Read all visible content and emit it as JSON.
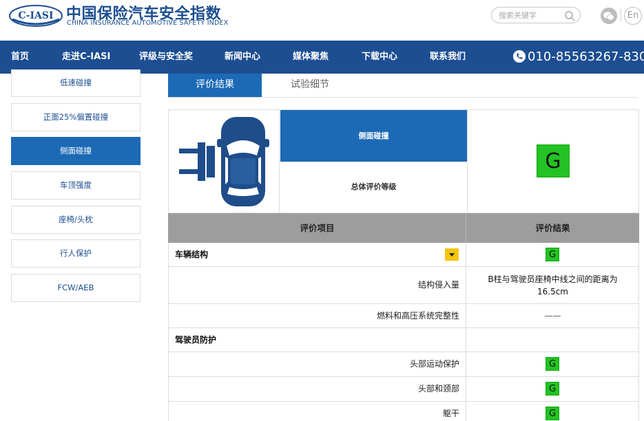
{
  "header": {
    "logo_badge": "C-IASI",
    "logo_cn": "中国保险汽车安全指数",
    "logo_en": "CHINA INSURANCE AUTOMOTIVE SAFETY INDEX",
    "search_placeholder": "搜索关键字",
    "lang_label": "En"
  },
  "nav": {
    "items": [
      "首页",
      "走进C-IASI",
      "评级与安全奖",
      "新闻中心",
      "媒体聚焦",
      "下载中心",
      "联系我们"
    ],
    "phone": "010-85563267-830"
  },
  "sidebar": {
    "items": [
      "低速碰撞",
      "正面25%偏置碰撞",
      "侧面碰撞",
      "车顶强度",
      "座椅/头枕",
      "行人保护",
      "FCW/AEB"
    ],
    "active": "侧面碰撞"
  },
  "tabs": [
    "评价结果",
    "试验细节"
  ],
  "summary": {
    "test_name": "侧面碰撞",
    "overall_label": "总体评价等级",
    "overall_grade": "G"
  },
  "table": {
    "headers": [
      "评价项目",
      "评价结果"
    ],
    "rows": [
      {
        "label": "车辆结构",
        "type": "category",
        "grade": "G"
      },
      {
        "label": "结构侵入量",
        "type": "item",
        "text": "B柱与驾驶员座椅中线之间的距离为16.5cm"
      },
      {
        "label": "燃料和高压系统完整性",
        "type": "item",
        "dash": "——"
      },
      {
        "label": "驾驶员防护",
        "type": "category"
      },
      {
        "label": "头部运动保护",
        "type": "item",
        "grade": "G"
      },
      {
        "label": "头部和颈部",
        "type": "item",
        "grade": "G"
      },
      {
        "label": "躯干",
        "type": "item",
        "grade": "G"
      }
    ]
  },
  "colors": {
    "brand_blue": "#1c4e91",
    "active_blue": "#1c6ab5",
    "grade_green": "#22c322",
    "toggle_yellow": "#f6c60b"
  }
}
